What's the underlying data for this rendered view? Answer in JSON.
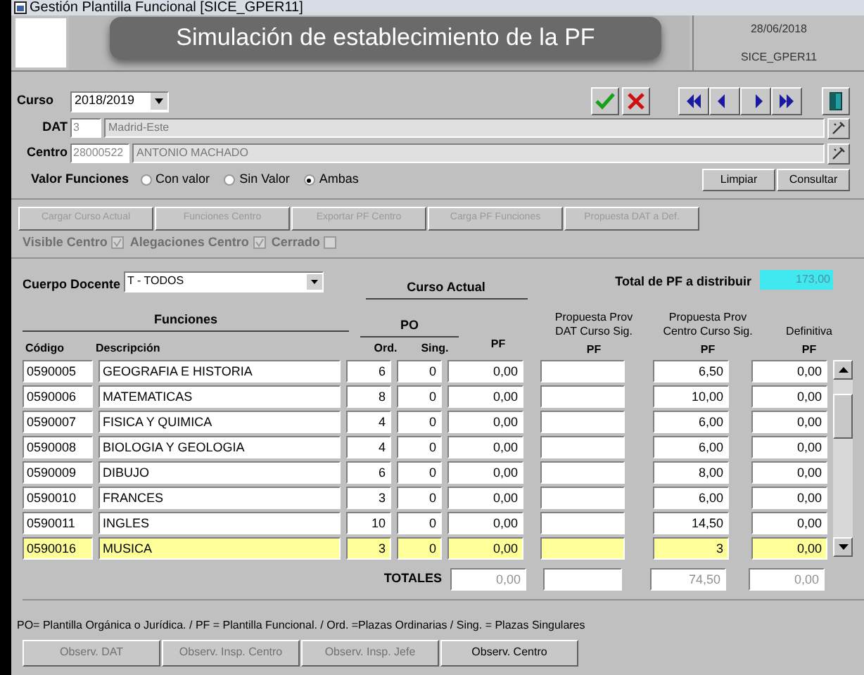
{
  "window": {
    "title": "Gestión Plantilla Funcional [SICE_GPER11]"
  },
  "banner": "Simulación de establecimiento de la PF",
  "header": {
    "date": "28/06/2018",
    "code": "SICE_GPER11"
  },
  "form": {
    "curso": {
      "label": "Curso",
      "value": "2018/2019"
    },
    "dat": {
      "label": "DAT",
      "code": "3",
      "name": "Madrid-Este"
    },
    "centro": {
      "label": "Centro",
      "code": "28000522",
      "name": "ANTONIO MACHADO"
    },
    "valor": {
      "label": "Valor Funciones",
      "options": [
        {
          "label": "Con valor",
          "selected": false
        },
        {
          "label": "Sin Valor",
          "selected": false
        },
        {
          "label": "Ambas",
          "selected": true
        }
      ]
    },
    "buttons": [
      "Limpiar",
      "Consultar"
    ]
  },
  "actions": [
    {
      "label": "Cargar Curso Actual",
      "disabled": true
    },
    {
      "label": "Funciones Centro",
      "disabled": true
    },
    {
      "label": "Exportar PF Centro",
      "disabled": true
    },
    {
      "label": "Carga PF Funciones",
      "disabled": true
    },
    {
      "label": "Propuesta DAT a Def.",
      "disabled": true
    }
  ],
  "flags": [
    {
      "label": "Visible Centro",
      "checked": true,
      "disabled": true
    },
    {
      "label": "Alegaciones Centro",
      "checked": true,
      "disabled": true
    },
    {
      "label": "Cerrado",
      "checked": false,
      "disabled": true
    }
  ],
  "cuerpo": {
    "label": "Cuerpo Docente",
    "value": "T - TODOS"
  },
  "total": {
    "label": "Total de PF a distribuir",
    "value": "173,00"
  },
  "groups": {
    "funciones": "Funciones",
    "curso_actual": "Curso Actual",
    "po": "PO"
  },
  "columns": {
    "codigo": "Código",
    "descripcion": "Descripción",
    "ord": "Ord.",
    "sing": "Sing.",
    "pf": "PF",
    "dat": [
      "Propuesta Prov",
      "DAT Curso Sig.",
      "PF"
    ],
    "centro": [
      "Propuesta Prov",
      "Centro Curso Sig.",
      "PF"
    ],
    "definitiva": [
      "Definitiva",
      "PF"
    ]
  },
  "rows": [
    {
      "codigo": "0590005",
      "descripcion": "GEOGRAFIA E HISTORIA",
      "ord": "6",
      "sing": "0",
      "pf": "0,00",
      "centro": "6,50",
      "definitiva": "0,00",
      "selected": false
    },
    {
      "codigo": "0590006",
      "descripcion": "MATEMATICAS",
      "ord": "8",
      "sing": "0",
      "pf": "0,00",
      "centro": "10,00",
      "definitiva": "0,00",
      "selected": false
    },
    {
      "codigo": "0590007",
      "descripcion": "FISICA Y QUIMICA",
      "ord": "4",
      "sing": "0",
      "pf": "0,00",
      "centro": "6,00",
      "definitiva": "0,00",
      "selected": false
    },
    {
      "codigo": "0590008",
      "descripcion": "BIOLOGIA Y GEOLOGIA",
      "ord": "4",
      "sing": "0",
      "pf": "0,00",
      "centro": "6,00",
      "definitiva": "0,00",
      "selected": false
    },
    {
      "codigo": "0590009",
      "descripcion": "DIBUJO",
      "ord": "6",
      "sing": "0",
      "pf": "0,00",
      "centro": "8,00",
      "definitiva": "0,00",
      "selected": false
    },
    {
      "codigo": "0590010",
      "descripcion": "FRANCES",
      "ord": "3",
      "sing": "0",
      "pf": "0,00",
      "centro": "6,00",
      "definitiva": "0,00",
      "selected": false
    },
    {
      "codigo": "0590011",
      "descripcion": "INGLES",
      "ord": "10",
      "sing": "0",
      "pf": "0,00",
      "centro": "14,50",
      "definitiva": "0,00",
      "selected": false
    },
    {
      "codigo": "0590016",
      "descripcion": "MUSICA",
      "ord": "3",
      "sing": "0",
      "pf": "0,00",
      "centro": "3",
      "definitiva": "0,00",
      "selected": true
    }
  ],
  "totals": {
    "label": "TOTALES",
    "pf": "0,00",
    "centro": "74,50",
    "definitiva": "0,00"
  },
  "legend": "PO= Plantilla Orgánica o Jurídica. / PF = Plantilla Funcional. / Ord. =Plazas Ordinarias / Sing. = Plazas Singulares",
  "observ": [
    {
      "label": "Observ. DAT",
      "disabled": true
    },
    {
      "label": "Observ. Insp. Centro",
      "disabled": true
    },
    {
      "label": "Observ. Insp. Jefe",
      "disabled": true
    },
    {
      "label": "Observ. Centro",
      "disabled": false
    }
  ]
}
